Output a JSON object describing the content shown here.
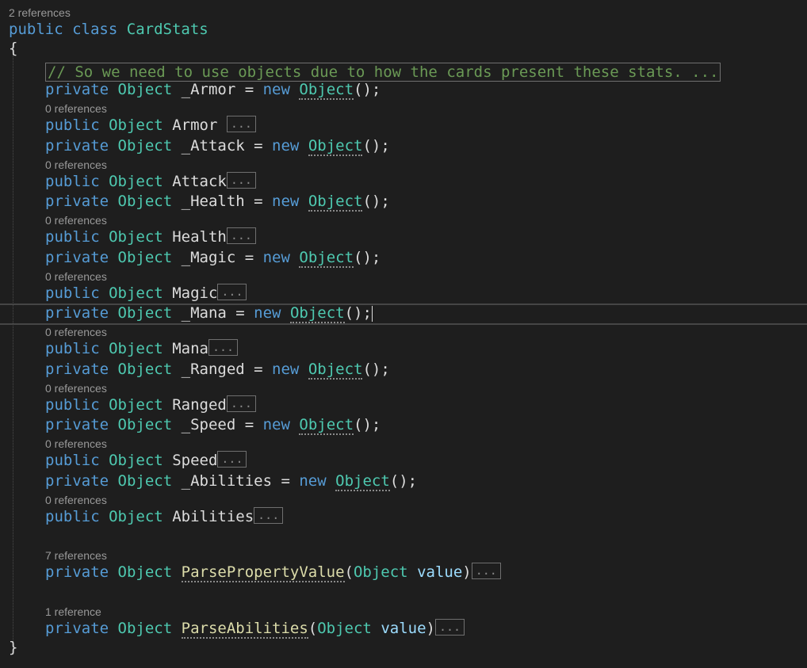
{
  "class_lens": "2 references",
  "class_decl": {
    "kw1": "public",
    "kw2": "class",
    "name": "CardStats"
  },
  "open_brace": "{",
  "close_brace": "}",
  "comment": "// So we need to use objects due to how the cards present these stats. ...",
  "kw_private": "private",
  "kw_public": "public",
  "kw_new": "new",
  "type_object": "Object",
  "collapsed": "...",
  "ctor_tail": "();",
  "zero_refs": "0 references",
  "fields": [
    {
      "field": "_Armor",
      "prop": "Armor"
    },
    {
      "field": "_Attack",
      "prop": "Attack"
    },
    {
      "field": "_Health",
      "prop": "Health"
    },
    {
      "field": "_Magic",
      "prop": "Magic"
    },
    {
      "field": "_Mana",
      "prop": "Mana"
    },
    {
      "field": "_Ranged",
      "prop": "Ranged"
    },
    {
      "field": "_Speed",
      "prop": "Speed"
    },
    {
      "field": "_Abilities",
      "prop": "Abilities"
    }
  ],
  "methods": [
    {
      "lens": "7 references",
      "name": "ParsePropertyValue",
      "param_type": "Object",
      "param_name": "value"
    },
    {
      "lens": "1 reference",
      "name": "ParseAbilities",
      "param_type": "Object",
      "param_name": "value"
    }
  ]
}
